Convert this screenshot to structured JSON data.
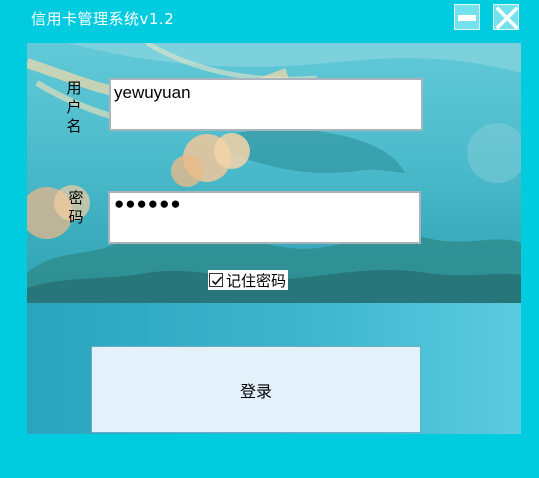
{
  "window": {
    "title": "信用卡管理系统v1.2"
  },
  "form": {
    "username_label": "用户名",
    "username_value": "yewuyuan",
    "password_label": "密码",
    "password_value": "●●●●●●",
    "remember_label": "记住密码",
    "remember_checked": true,
    "login_label": "登录"
  },
  "colors": {
    "window_bg": "#00cbdf",
    "button_bg": "#e4f1fa"
  },
  "icons": {
    "minimize": "minimize-icon",
    "close": "close-icon",
    "check": "check-icon"
  }
}
